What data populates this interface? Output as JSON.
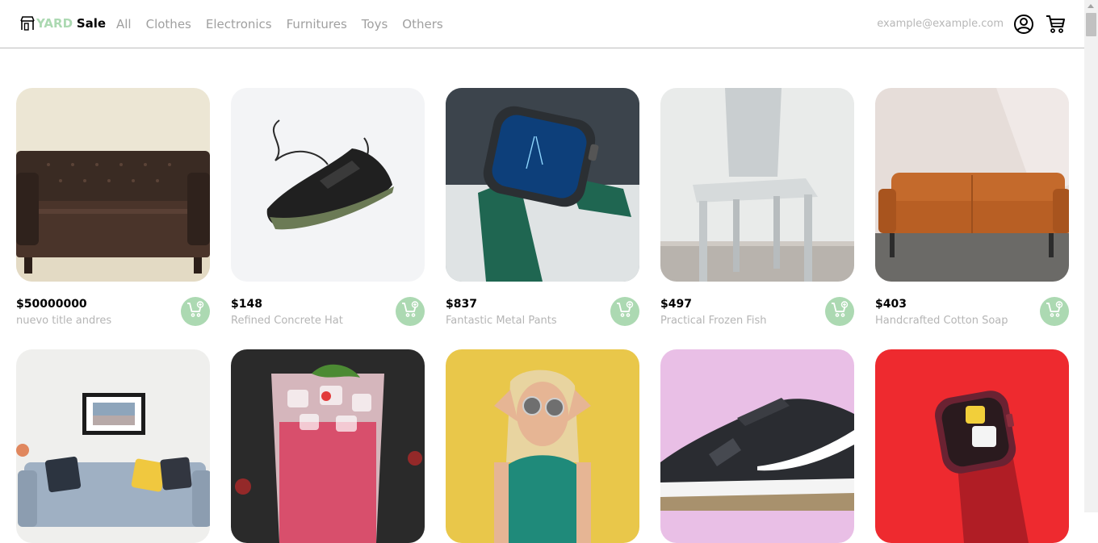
{
  "logo": {
    "brand_part1": "YARD",
    "brand_part2": "Sale"
  },
  "nav": {
    "categories": [
      "All",
      "Clothes",
      "Electronics",
      "Furnitures",
      "Toys",
      "Others"
    ]
  },
  "user": {
    "email": "example@example.com"
  },
  "icons": {
    "logo": "storefront-icon",
    "account": "user-circle-icon",
    "cart": "shopping-cart-icon",
    "add_to_cart": "cart-plus-icon"
  },
  "colors": {
    "accent": "#acd9b2",
    "nav_text": "#a0a0a0",
    "title_text": "#b5b5b5"
  },
  "products": [
    {
      "price": "$50000000",
      "title": "nuevo title andres"
    },
    {
      "price": "$148",
      "title": "Refined Concrete Hat"
    },
    {
      "price": "$837",
      "title": "Fantastic Metal Pants"
    },
    {
      "price": "$497",
      "title": "Practical Frozen Fish"
    },
    {
      "price": "$403",
      "title": "Handcrafted Cotton Soap"
    },
    {
      "price": "",
      "title": ""
    },
    {
      "price": "",
      "title": ""
    },
    {
      "price": "",
      "title": ""
    },
    {
      "price": "",
      "title": ""
    },
    {
      "price": "",
      "title": ""
    }
  ]
}
